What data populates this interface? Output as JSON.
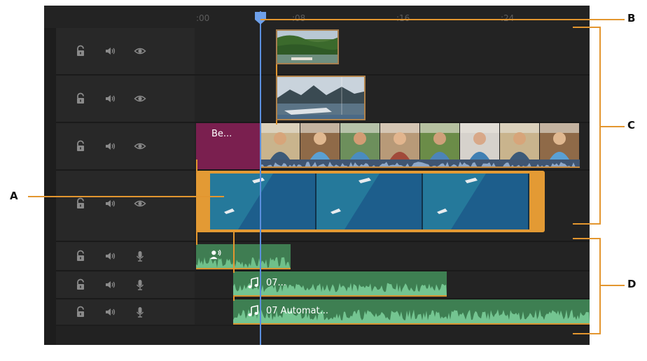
{
  "ruler": {
    "ticks": [
      ":00",
      ":08",
      ":16",
      ":24"
    ]
  },
  "tracks": {
    "video": [
      {
        "icons": [
          "lock-icon",
          "speaker-icon",
          "eye-icon"
        ]
      },
      {
        "icons": [
          "lock-icon",
          "speaker-icon",
          "eye-icon"
        ]
      },
      {
        "icons": [
          "lock-icon",
          "speaker-icon",
          "eye-icon"
        ]
      },
      {
        "icons": [
          "lock-icon",
          "speaker-icon",
          "eye-icon"
        ]
      }
    ],
    "audio": [
      {
        "icons": [
          "lock-icon",
          "speaker-icon",
          "microphone-icon"
        ]
      },
      {
        "icons": [
          "lock-icon",
          "speaker-icon",
          "microphone-icon"
        ]
      },
      {
        "icons": [
          "lock-icon",
          "speaker-icon",
          "microphone-icon"
        ]
      }
    ]
  },
  "clips": {
    "title_clip_label": "Be...",
    "music_clip_1_label": "07...",
    "music_clip_2_label": "07 Automat..."
  },
  "callouts": {
    "a": "A",
    "b": "B",
    "c": "C",
    "d": "D"
  },
  "colors": {
    "callout_line": "#e3962f",
    "playhead": "#5b8fde",
    "title_clip": "#7a1f4f",
    "audio_clip": "#3f7d52",
    "selected_clip_border": "#e3962f"
  }
}
